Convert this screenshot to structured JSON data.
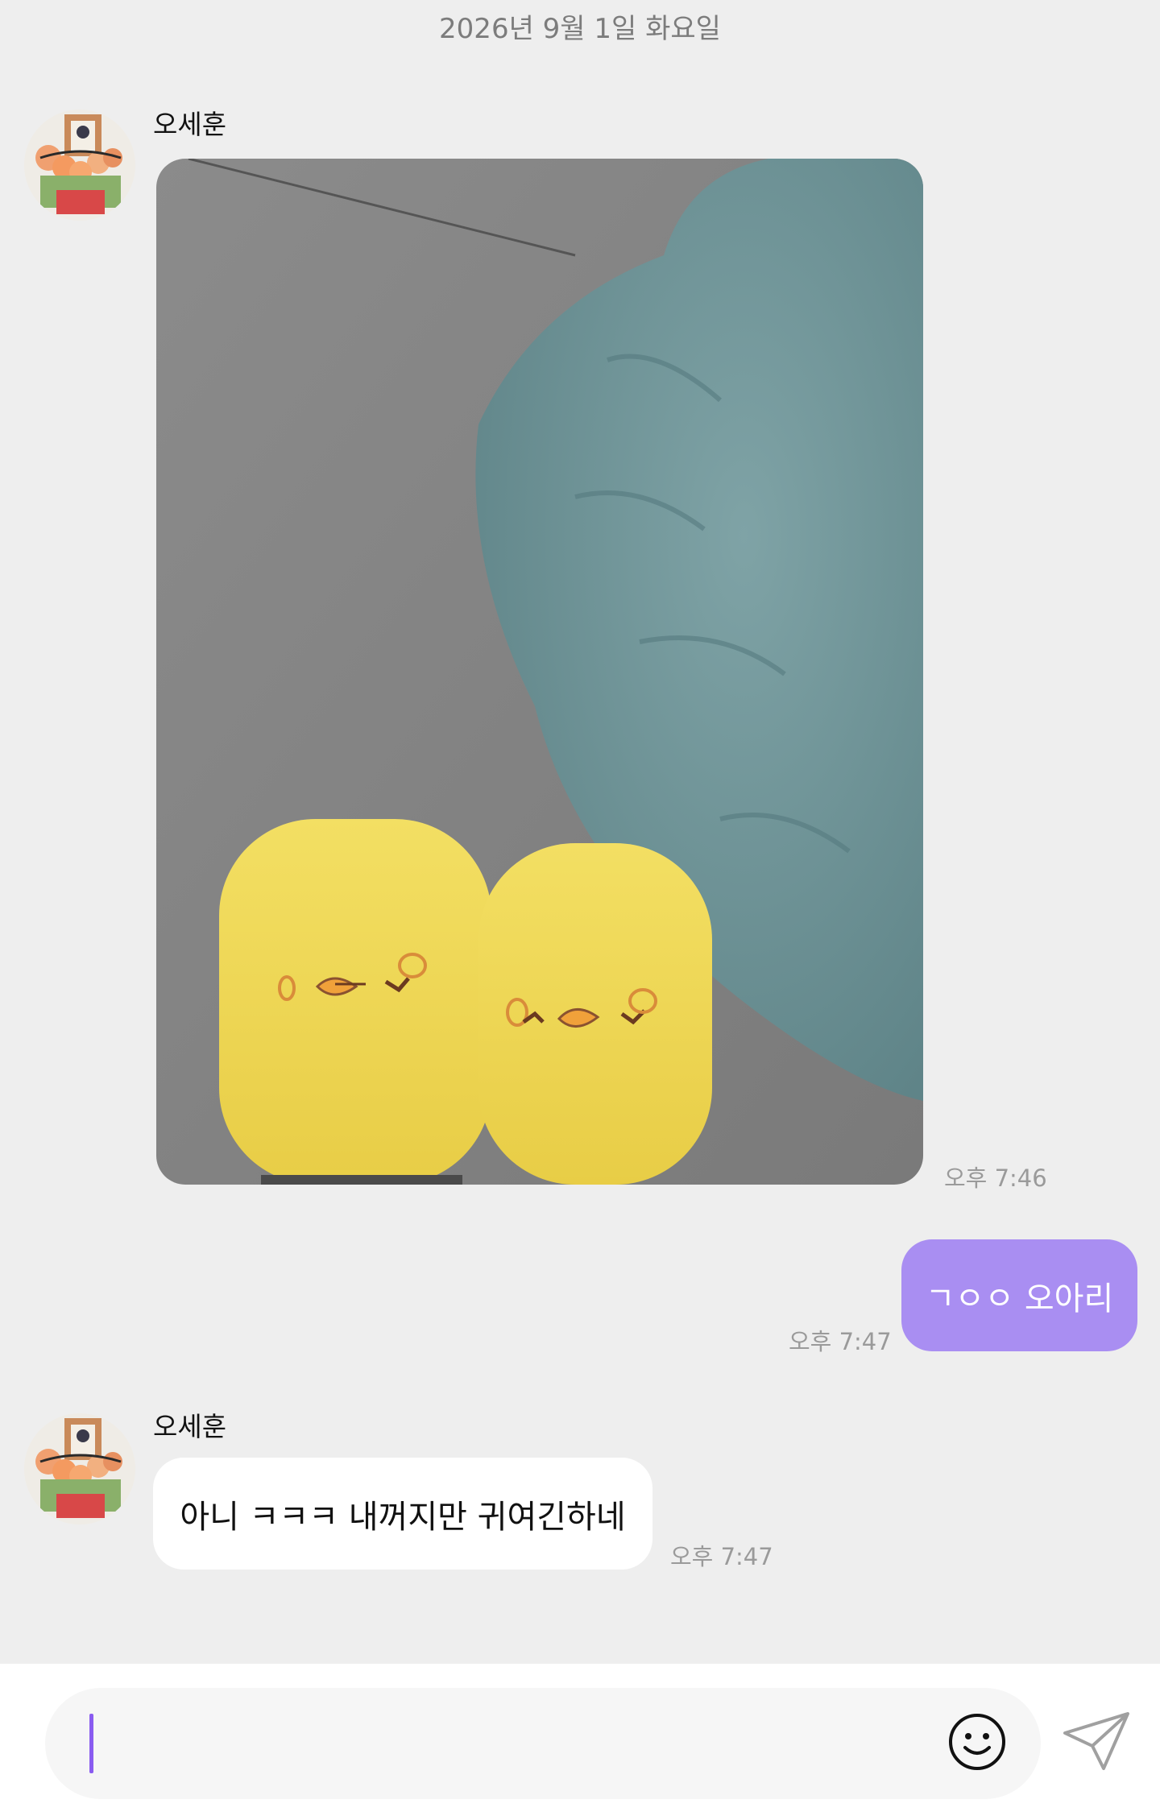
{
  "header": {
    "date": "2026년 9월 1일 화요일"
  },
  "messages": [
    {
      "sender": "오세훈",
      "type": "photo",
      "time": "오후 7:46"
    },
    {
      "type": "outgoing_text",
      "text": "ㄱㅇㅇ 오아리",
      "time": "오후 7:47"
    },
    {
      "sender": "오세훈",
      "type": "incoming_text",
      "text": "아니 ㅋㅋㅋ 내꺼지만 귀여긴하네",
      "time": "오후 7:47"
    }
  ],
  "composer": {
    "emoji_icon": "smiley-icon",
    "send_icon": "paper-plane-icon"
  },
  "colors": {
    "background": "#eeeeee",
    "outgoing_bubble": "#a98ef2",
    "incoming_bubble": "#ffffff",
    "caret": "#8a5cf0"
  }
}
